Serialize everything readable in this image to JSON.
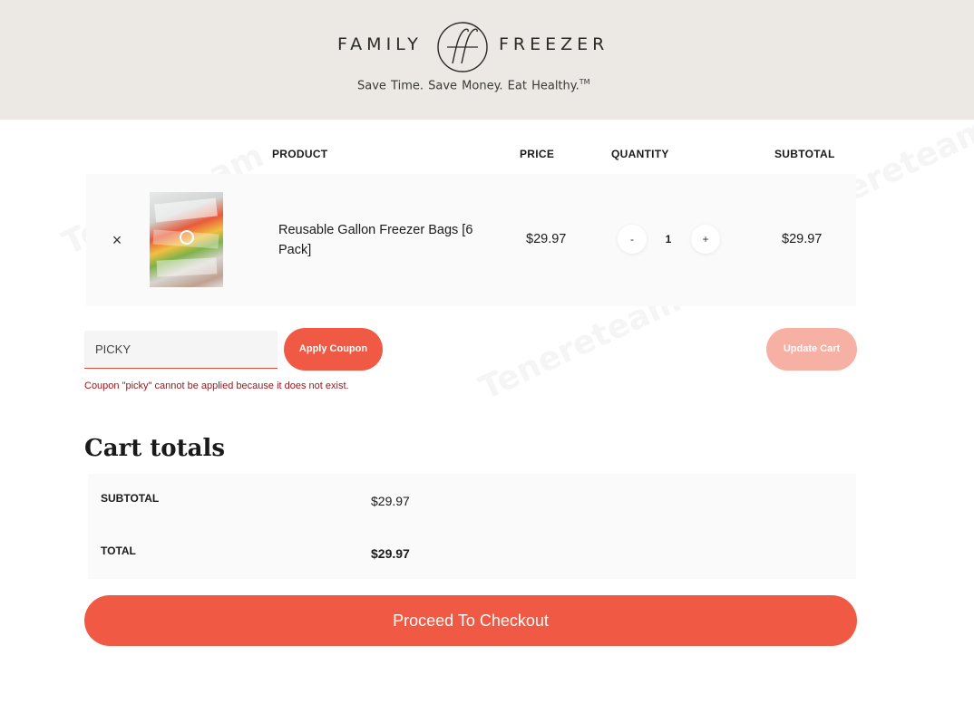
{
  "header": {
    "brand_left": "FAMILY",
    "brand_right": "FREEZER",
    "tagline": "Save Time.   Save Money.   Eat Healthy.",
    "tagline_mark": "TM"
  },
  "cart_table": {
    "headers": {
      "product": "PRODUCT",
      "price": "PRICE",
      "quantity": "QUANTITY",
      "subtotal": "SUBTOTAL"
    },
    "items": [
      {
        "remove_icon": "×",
        "name": "Reusable Gallon Freezer Bags [6 Pack]",
        "price": "$29.97",
        "quantity": "1",
        "decrement": "-",
        "increment": "+",
        "subtotal": "$29.97"
      }
    ]
  },
  "coupon": {
    "value": "PICKY",
    "apply_label": "Apply Coupon",
    "update_label": "Update Cart",
    "error": "Coupon \"picky\" cannot be applied because it does not exist."
  },
  "totals": {
    "title": "Cart totals",
    "subtotal_label": "SUBTOTAL",
    "subtotal_value": "$29.97",
    "total_label": "TOTAL",
    "total_value": "$29.97"
  },
  "checkout": {
    "label": "Proceed To Checkout"
  },
  "watermark": "Tenereteam",
  "colors": {
    "header_bg": "#ece8e4",
    "accent": "#f05a45",
    "accent_disabled": "#f7b0a4",
    "error": "#a3141a"
  }
}
